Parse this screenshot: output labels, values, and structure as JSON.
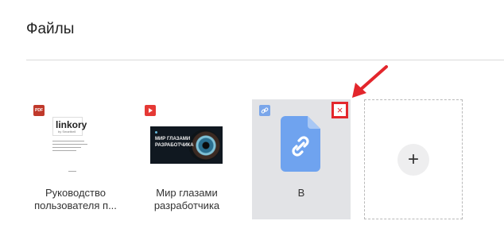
{
  "page": {
    "title": "Файлы"
  },
  "files": [
    {
      "type": "pdf",
      "badge": "PDF",
      "caption_line1": "Руководство",
      "caption_line2": "пользователя п...",
      "thumb_logo": "linkory",
      "thumb_logo_small": "by Smartbell"
    },
    {
      "type": "youtube",
      "caption_line1": "Мир глазами",
      "caption_line2": "разработчика",
      "thumb_text_line1": "МИР ГЛАЗАМИ",
      "thumb_text_line2": "РАЗРАБОТЧИКА"
    },
    {
      "type": "link",
      "caption_line1": "B",
      "close_glyph": "×"
    }
  ],
  "add_card": {
    "glyph": "+"
  },
  "colors": {
    "highlight": "#e3262c",
    "link_icon": "#6fa3ef",
    "card_selected_bg": "#e2e3e6"
  }
}
